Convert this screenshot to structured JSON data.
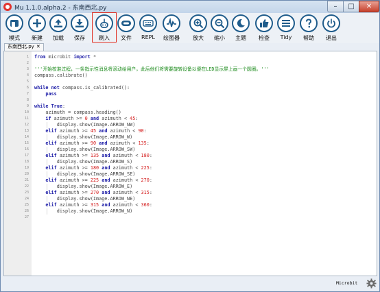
{
  "window": {
    "title": "Mu 1.1.0.alpha.2 - 东南西北.py",
    "controls": {
      "minimize": "–",
      "maximize": "□",
      "close": "✕"
    }
  },
  "toolbar": {
    "buttons": [
      {
        "label": "模式",
        "icon": "mode-icon"
      },
      {
        "label": "新建",
        "icon": "plus-icon"
      },
      {
        "label": "加载",
        "icon": "load-icon"
      },
      {
        "label": "保存",
        "icon": "save-icon"
      },
      {
        "label": "刷入",
        "icon": "flash-icon",
        "active": true
      },
      {
        "label": "文件",
        "icon": "files-icon"
      },
      {
        "label": "REPL",
        "icon": "keyboard-icon"
      },
      {
        "label": "绘图器",
        "icon": "plotter-icon"
      },
      {
        "label": "放大",
        "icon": "zoom-in-icon"
      },
      {
        "label": "缩小",
        "icon": "zoom-out-icon"
      },
      {
        "label": "主题",
        "icon": "theme-icon"
      },
      {
        "label": "检查",
        "icon": "check-icon"
      },
      {
        "label": "Tidy",
        "icon": "tidy-icon"
      },
      {
        "label": "帮助",
        "icon": "help-icon"
      },
      {
        "label": "退出",
        "icon": "quit-icon"
      }
    ],
    "highlight_color": "#e0281c"
  },
  "tabs": [
    {
      "label": "东南西北.py",
      "close": "✕"
    }
  ],
  "editor": {
    "line_numbers": [
      "1",
      "2",
      "3",
      "4",
      "5",
      "6",
      "7",
      "8",
      "9",
      "10",
      "11",
      "12",
      "13",
      "14",
      "15",
      "16",
      "17",
      "18",
      "19",
      "20",
      "21",
      "22",
      "23",
      "24",
      "25",
      "26",
      "27"
    ],
    "lines": [
      "from microbit import *",
      "",
      "'''开始校准过程，一条指示性消息将滚动给用户，此后他们将需要旋转设备以便在LED显示屏上画一个圆圈。'''",
      "compass.calibrate()",
      "",
      "while not compass.is_calibrated():",
      "    pass",
      "",
      "while True:",
      "    azimuth = compass.heading()",
      "    if azimuth >= 0 and azimuth < 45:",
      "        display.show(Image.ARROW_NW)",
      "    elif azimuth >= 45 and azimuth < 90:",
      "        display.show(Image.ARROW_W)",
      "    elif azimuth >= 90 and azimuth < 135:",
      "        display.show(Image.ARROW_SW)",
      "    elif azimuth >= 135 and azimuth < 180:",
      "        display.show(Image.ARROW_S)",
      "    elif azimuth >= 180 and azimuth < 225:",
      "        display.show(Image.ARROW_SE)",
      "    elif azimuth >= 225 and azimuth < 270:",
      "        display.show(Image.ARROW_E)",
      "    elif azimuth >= 270 and azimuth < 315:",
      "        display.show(Image.ARROW_NE)",
      "    elif azimuth >= 315 and azimuth < 360:",
      "        display.show(Image.ARROW_N)",
      ""
    ],
    "colors": {
      "keyword": "#1a1aa6",
      "number": "#d41a1a",
      "string": "#1a8a1a",
      "plain": "#444444"
    }
  },
  "status": {
    "device": "Microbit",
    "settings_icon": "gear-icon"
  }
}
